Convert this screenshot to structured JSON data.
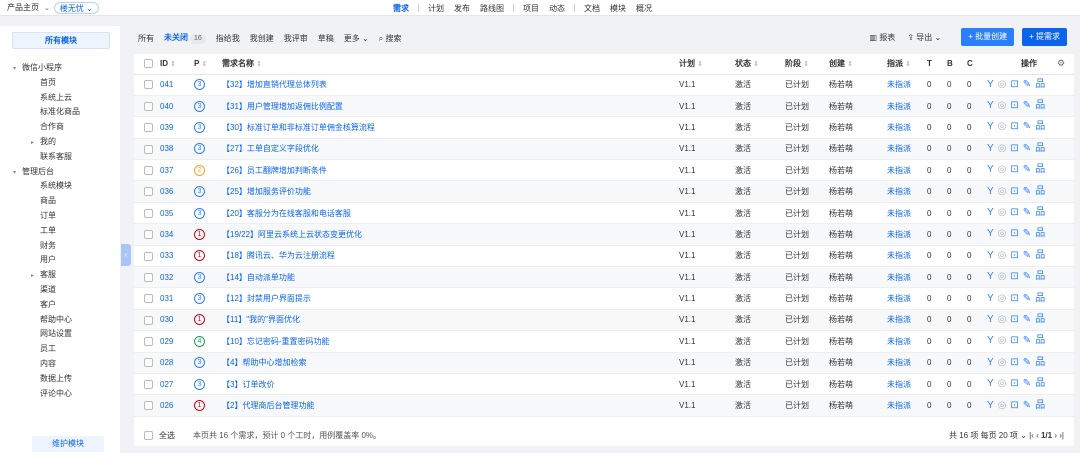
{
  "breadcrumb": {
    "product": "产品主页",
    "project": "楼无忧"
  },
  "nav": [
    "需求",
    "计划",
    "发布",
    "路线图",
    "项目",
    "动态",
    "文档",
    "模块",
    "概况"
  ],
  "sidebar": {
    "header": "所有模块",
    "tree": [
      {
        "label": "微信小程序",
        "level": 0,
        "caret": "▾"
      },
      {
        "label": "首页",
        "level": 1
      },
      {
        "label": "系统上云",
        "level": 1
      },
      {
        "label": "标准化商品",
        "level": 1
      },
      {
        "label": "合作商",
        "level": 1
      },
      {
        "label": "我的",
        "level": 1,
        "caret": "▸"
      },
      {
        "label": "联系客服",
        "level": 1
      },
      {
        "label": "管理后台",
        "level": 0,
        "caret": "▾"
      },
      {
        "label": "系统模块",
        "level": 1
      },
      {
        "label": "商品",
        "level": 1
      },
      {
        "label": "订单",
        "level": 1
      },
      {
        "label": "工单",
        "level": 1
      },
      {
        "label": "财务",
        "level": 1
      },
      {
        "label": "用户",
        "level": 1
      },
      {
        "label": "客服",
        "level": 1,
        "caret": "▸"
      },
      {
        "label": "渠道",
        "level": 1
      },
      {
        "label": "客户",
        "level": 1
      },
      {
        "label": "帮助中心",
        "level": 1
      },
      {
        "label": "网站设置",
        "level": 1
      },
      {
        "label": "员工",
        "level": 1
      },
      {
        "label": "内容",
        "level": 1
      },
      {
        "label": "数据上传",
        "level": 1
      },
      {
        "label": "评论中心",
        "level": 1
      }
    ],
    "footer": "维护模块"
  },
  "toolbar": {
    "tabs": [
      "所有",
      "未关闭",
      "指给我",
      "我创建",
      "我评审",
      "草稿",
      "更多"
    ],
    "active_count": "16",
    "search": "搜索",
    "report": "报表",
    "export": "导出",
    "batch_create": "+ 批量创建",
    "create": "+ 提需求"
  },
  "table": {
    "headers": [
      "ID",
      "P",
      "需求名称",
      "计划",
      "状态",
      "阶段",
      "创建",
      "指派",
      "T",
      "B",
      "C",
      "操作"
    ],
    "rows": [
      {
        "id": "041",
        "p": "3",
        "name": "【32】增加直销代理总体列表",
        "plan": "V1.1",
        "status": "激活",
        "stage": "已计划",
        "creator": "杨若萌",
        "assign": "未指派",
        "t": "0",
        "b": "0",
        "c": "0"
      },
      {
        "id": "040",
        "p": "3",
        "name": "【31】用户管理增加返佣比例配置",
        "plan": "V1.1",
        "status": "激活",
        "stage": "已计划",
        "creator": "杨若萌",
        "assign": "未指派",
        "t": "0",
        "b": "0",
        "c": "0"
      },
      {
        "id": "039",
        "p": "3",
        "name": "【30】标准订单和非标准订单佣金核算流程",
        "plan": "V1.1",
        "status": "激活",
        "stage": "已计划",
        "creator": "杨若萌",
        "assign": "未指派",
        "t": "0",
        "b": "0",
        "c": "0"
      },
      {
        "id": "038",
        "p": "3",
        "name": "【27】工单自定义字段优化",
        "plan": "V1.1",
        "status": "激活",
        "stage": "已计划",
        "creator": "杨若萌",
        "assign": "未指派",
        "t": "0",
        "b": "0",
        "c": "0"
      },
      {
        "id": "037",
        "p": "2",
        "name": "【26】员工翻牌增加判断条件",
        "plan": "V1.1",
        "status": "激活",
        "stage": "已计划",
        "creator": "杨若萌",
        "assign": "未指派",
        "t": "0",
        "b": "0",
        "c": "0"
      },
      {
        "id": "036",
        "p": "3",
        "name": "【25】增加服务评价功能",
        "plan": "V1.1",
        "status": "激活",
        "stage": "已计划",
        "creator": "杨若萌",
        "assign": "未指派",
        "t": "0",
        "b": "0",
        "c": "0"
      },
      {
        "id": "035",
        "p": "3",
        "name": "【20】客服分为在线客服和电话客服",
        "plan": "V1.1",
        "status": "激活",
        "stage": "已计划",
        "creator": "杨若萌",
        "assign": "未指派",
        "t": "0",
        "b": "0",
        "c": "0"
      },
      {
        "id": "034",
        "p": "1",
        "name": "【19/22】阿里云系统上云状态变更优化",
        "plan": "V1.1",
        "status": "激活",
        "stage": "已计划",
        "creator": "杨若萌",
        "assign": "未指派",
        "t": "0",
        "b": "0",
        "c": "0"
      },
      {
        "id": "033",
        "p": "1",
        "name": "【18】腾讯云、华为云注册流程",
        "plan": "V1.1",
        "status": "激活",
        "stage": "已计划",
        "creator": "杨若萌",
        "assign": "未指派",
        "t": "0",
        "b": "0",
        "c": "0"
      },
      {
        "id": "032",
        "p": "3",
        "name": "【14】自动派单功能",
        "plan": "V1.1",
        "status": "激活",
        "stage": "已计划",
        "creator": "杨若萌",
        "assign": "未指派",
        "t": "0",
        "b": "0",
        "c": "0"
      },
      {
        "id": "031",
        "p": "3",
        "name": "【12】封禁用户界面提示",
        "plan": "V1.1",
        "status": "激活",
        "stage": "已计划",
        "creator": "杨若萌",
        "assign": "未指派",
        "t": "0",
        "b": "0",
        "c": "0"
      },
      {
        "id": "030",
        "p": "1",
        "name": "【11】\"我的\"界面优化",
        "plan": "V1.1",
        "status": "激活",
        "stage": "已计划",
        "creator": "杨若萌",
        "assign": "未指派",
        "t": "0",
        "b": "0",
        "c": "0"
      },
      {
        "id": "029",
        "p": "4",
        "name": "【10】忘记密码-重置密码功能",
        "plan": "V1.1",
        "status": "激活",
        "stage": "已计划",
        "creator": "杨若萌",
        "assign": "未指派",
        "t": "0",
        "b": "0",
        "c": "0"
      },
      {
        "id": "028",
        "p": "3",
        "name": "【4】帮助中心增加检索",
        "plan": "V1.1",
        "status": "激活",
        "stage": "已计划",
        "creator": "杨若萌",
        "assign": "未指派",
        "t": "0",
        "b": "0",
        "c": "0"
      },
      {
        "id": "027",
        "p": "3",
        "name": "【3】订单改价",
        "plan": "V1.1",
        "status": "激活",
        "stage": "已计划",
        "creator": "杨若萌",
        "assign": "未指派",
        "t": "0",
        "b": "0",
        "c": "0"
      },
      {
        "id": "026",
        "p": "1",
        "name": "【2】代理商后台管理功能",
        "plan": "V1.1",
        "status": "激活",
        "stage": "已计划",
        "creator": "杨若萌",
        "assign": "未指派",
        "t": "0",
        "b": "0",
        "c": "0"
      }
    ],
    "select_all": "全选",
    "summary": "本页共 16 个需求，预计 0 个工时，用例覆盖率 0%。",
    "pager": {
      "total": "共 16 项",
      "per_page": "每页 20 项",
      "page": "1/1"
    }
  },
  "colors": {
    "accent": "#0c64eb",
    "p1": "#d0021b",
    "p2": "#f5a623",
    "p3": "#2b7fff",
    "p4": "#1e9e5a"
  },
  "icons": {
    "ops": [
      "branch-icon",
      "glasses-icon",
      "box-icon",
      "edit-icon",
      "flow-icon"
    ]
  }
}
